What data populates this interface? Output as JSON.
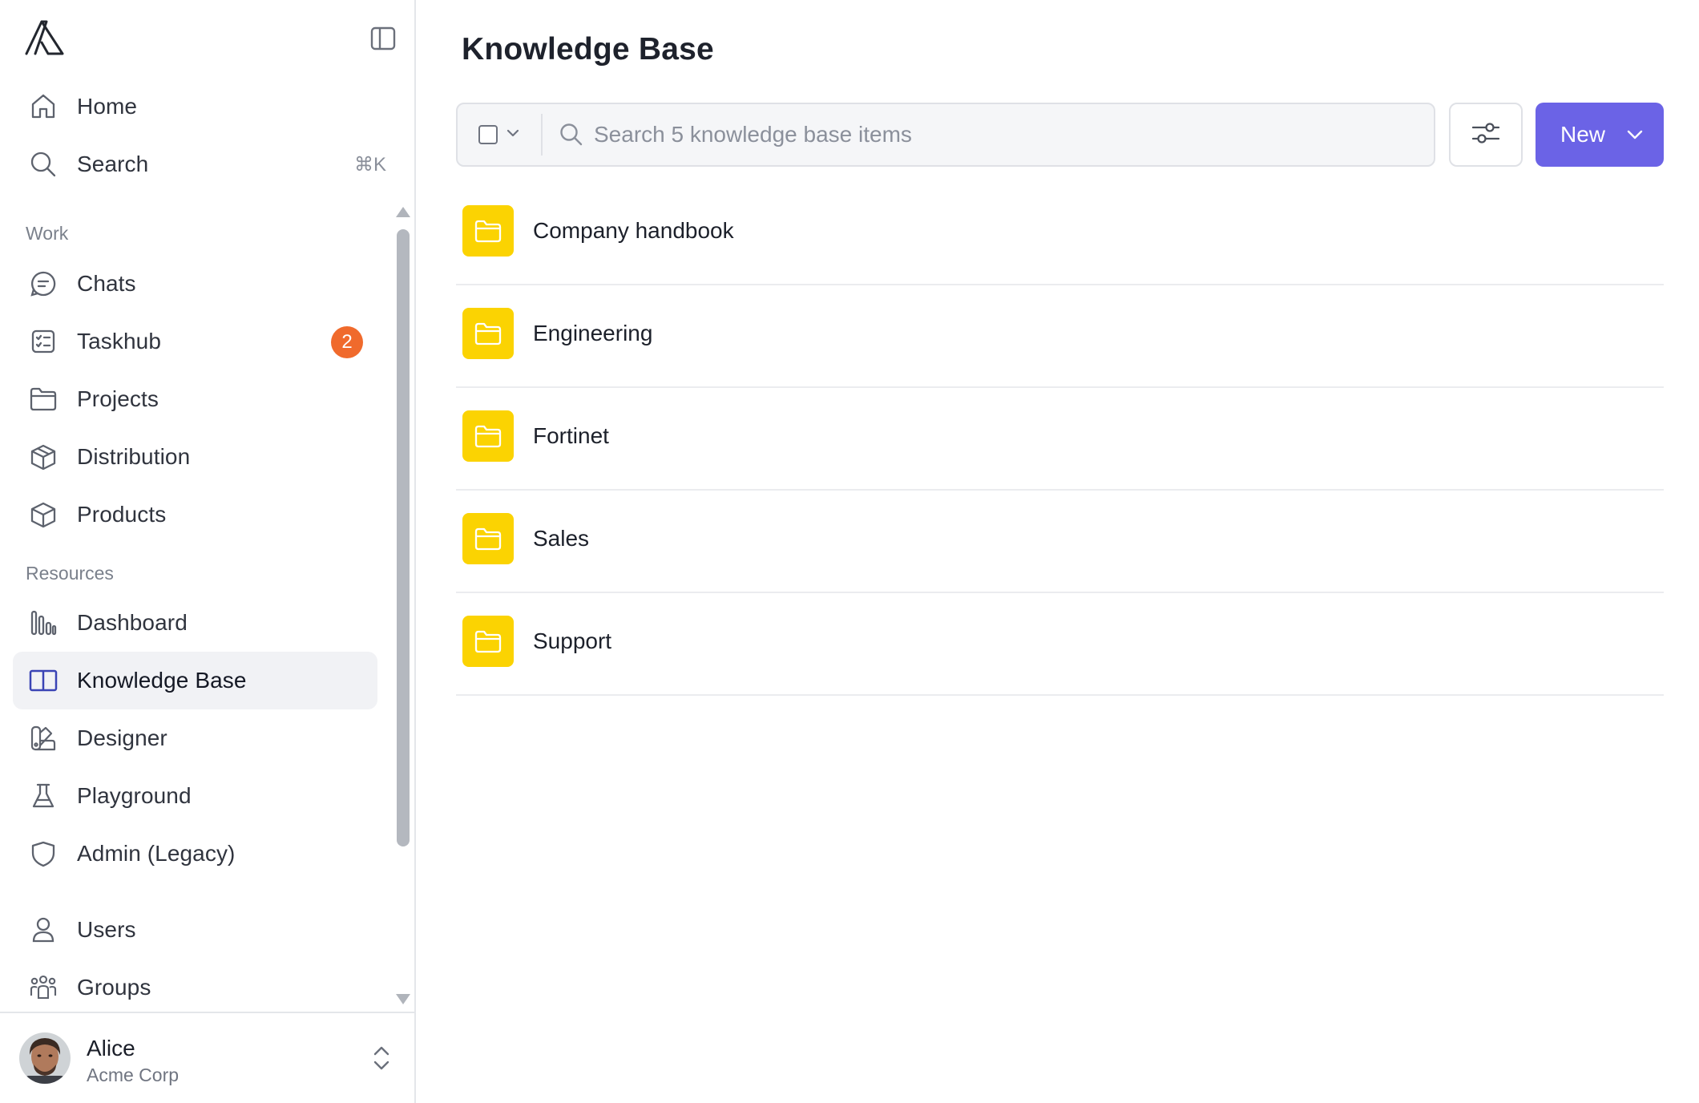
{
  "sidebar": {
    "top_items": [
      {
        "label": "Home",
        "icon": "home-icon"
      },
      {
        "label": "Search",
        "icon": "search-icon",
        "shortcut": "⌘K"
      }
    ],
    "sections": [
      {
        "label": "Work",
        "items": [
          {
            "label": "Chats",
            "icon": "chat-icon"
          },
          {
            "label": "Taskhub",
            "icon": "checklist-icon",
            "badge": "2"
          },
          {
            "label": "Projects",
            "icon": "folder-icon"
          },
          {
            "label": "Distribution",
            "icon": "box-icon"
          },
          {
            "label": "Products",
            "icon": "cube-icon"
          }
        ]
      },
      {
        "label": "Resources",
        "items": [
          {
            "label": "Dashboard",
            "icon": "bar-chart-icon"
          },
          {
            "label": "Knowledge Base",
            "icon": "book-open-icon",
            "active": true
          },
          {
            "label": "Designer",
            "icon": "palette-icon"
          },
          {
            "label": "Playground",
            "icon": "flask-icon"
          },
          {
            "label": "Admin (Legacy)",
            "icon": "shield-icon"
          }
        ]
      },
      {
        "label": "",
        "items": [
          {
            "label": "Users",
            "icon": "user-icon"
          },
          {
            "label": "Groups",
            "icon": "users-group-icon"
          }
        ]
      }
    ],
    "user": {
      "name": "Alice",
      "org": "Acme Corp"
    }
  },
  "main": {
    "title": "Knowledge Base",
    "search_placeholder": "Search 5 knowledge base items",
    "new_label": "New",
    "items": [
      {
        "name": "Company handbook",
        "icon": "folder-icon"
      },
      {
        "name": "Engineering",
        "icon": "folder-icon"
      },
      {
        "name": "Fortinet",
        "icon": "folder-icon"
      },
      {
        "name": "Sales",
        "icon": "folder-icon"
      },
      {
        "name": "Support",
        "icon": "folder-icon"
      }
    ]
  },
  "colors": {
    "accent": "#6b63e6",
    "badge": "#f06a2c",
    "folder": "#fbd302",
    "active_bg": "#f1f2f5"
  }
}
